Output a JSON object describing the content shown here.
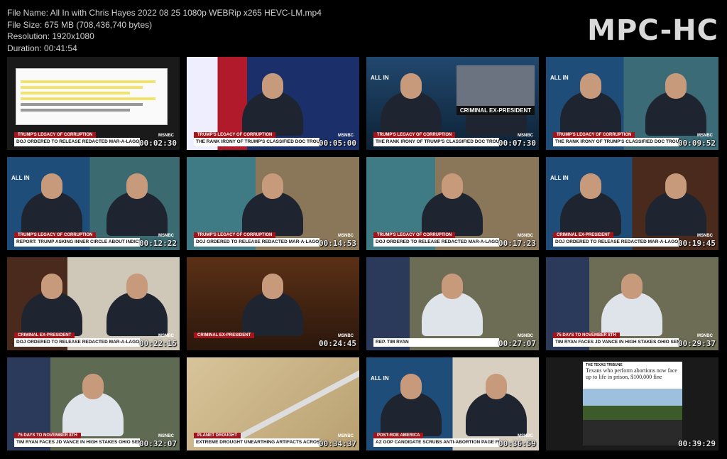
{
  "file_info": {
    "name": "File Name: All In with Chris Hayes 2022 08 25 1080p WEBRip x265 HEVC-LM.mp4",
    "size": "File Size: 675 MB (708,436,740 bytes)",
    "resolution": "Resolution: 1920x1080",
    "duration": "Duration: 00:41:54"
  },
  "logo": "MPC-HC",
  "thumbnails": [
    {
      "tag": "TRUMP'S LEGACY OF CORRUPTION",
      "caption": "DOJ ORDERED TO RELEASE REDACTED MAR-A-LAGO AFFADAVIT",
      "time": "00:02:30"
    },
    {
      "tag": "TRUMP'S LEGACY OF CORRUPTION",
      "caption": "THE RANK IRONY OF TRUMP'S CLASSIFIED DOC TROUBLE",
      "time": "00:05:00"
    },
    {
      "tag": "TRUMP'S LEGACY OF CORRUPTION",
      "caption": "THE RANK IRONY OF TRUMP'S CLASSIFIED DOC TROUBLE",
      "time": "00:07:30",
      "overlay": "CRIMINAL EX-PRESIDENT"
    },
    {
      "tag": "TRUMP'S LEGACY OF CORRUPTION",
      "caption": "THE RANK IRONY OF TRUMP'S CLASSIFIED DOC TROUBLE",
      "time": "00:09:52"
    },
    {
      "tag": "TRUMP'S LEGACY OF CORRUPTION",
      "caption": "REPORT: TRUMP ASKING INNER CIRCLE ABOUT INDICTMENT RISK",
      "time": "00:12:22"
    },
    {
      "tag": "TRUMP'S LEGACY OF CORRUPTION",
      "caption": "DOJ ORDERED TO RELEASE REDACTED MAR-A-LAGO AFFADAVIT",
      "time": "00:14:53"
    },
    {
      "tag": "TRUMP'S LEGACY OF CORRUPTION",
      "caption": "DOJ ORDERED TO RELEASE REDACTED MAR-A-LAGO AFFADAVIT",
      "time": "00:17:23"
    },
    {
      "tag": "CRIMINAL EX-PRESIDENT",
      "caption": "DOJ ORDERED TO RELEASE REDACTED MAR-A-LAGO AFFADAVIT",
      "time": "00:19:45"
    },
    {
      "tag": "CRIMINAL EX-PRESIDENT",
      "caption": "DOJ ORDERED TO RELEASE REDACTED MAR-A-LAGO AFFADAVIT",
      "time": "00:22:15"
    },
    {
      "tag": "CRIMINAL EX-PRESIDENT",
      "caption": "",
      "time": "00:24:45"
    },
    {
      "tag": "",
      "caption": "REP. TIM RYAN",
      "time": "00:27:07"
    },
    {
      "tag": "75 DAYS TO NOVEMBER 8TH",
      "caption": "TIM RYAN FACES JD VANCE IN HIGH STAKES OHIO SENATE RACE",
      "time": "00:29:37"
    },
    {
      "tag": "75 DAYS TO NOVEMBER 8TH",
      "caption": "TIM RYAN FACES JD VANCE IN HIGH STAKES OHIO SENATE RACE",
      "time": "00:32:07"
    },
    {
      "tag": "PLANET DROUGHT",
      "caption": "EXTREME DROUGHT UNEARTHING ARTIFACTS ACROSS GLOBE",
      "time": "00:34:37"
    },
    {
      "tag": "POST-ROE AMERICA",
      "caption": "AZ GOP CANDIDATE SCRUBS ANTI-ABORTION PAGE FROM WEBSITE",
      "time": "00:36:59"
    },
    {
      "tag": "",
      "caption": "",
      "time": "00:39:29",
      "headline_source": "THE TEXAS TRIBUNE",
      "headline": "Texans who perform abortions now face up to life in prison, $100,000 fine"
    }
  ],
  "network": "MSNBC",
  "corner": "ALL IN"
}
